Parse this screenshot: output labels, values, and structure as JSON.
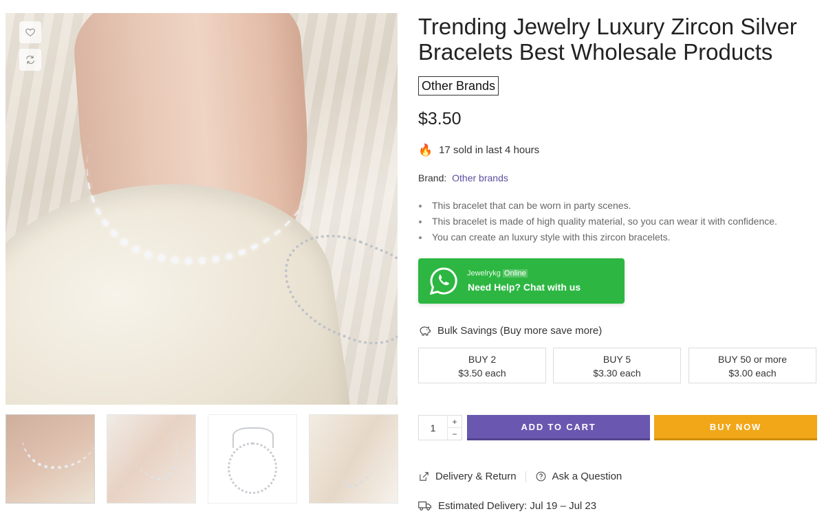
{
  "product": {
    "title": "Trending Jewelry Luxury Zircon Silver Bracelets Best Wholesale Products",
    "brand_badge": "Other Brands",
    "price": "$3.50",
    "sold_text": "17 sold in last 4 hours",
    "brand_label": "Brand:",
    "brand_value": "Other brands",
    "features": [
      "This bracelet that can be worn in party scenes.",
      "This bracelet is made of high quality material, so you can wear it with confidence.",
      "You can create an luxury style with this zircon bracelets."
    ]
  },
  "gallery": {
    "wishlist_icon": "heart-icon",
    "compare_icon": "refresh-icon",
    "thumbnail_count": 4
  },
  "whatsapp": {
    "name": "Jewelrykg",
    "status": "Online",
    "cta": "Need Help? Chat with us",
    "color": "#2db742"
  },
  "bulk": {
    "title": "Bulk Savings (Buy more save more)",
    "tiers": [
      {
        "qty": "BUY 2",
        "price": "$3.50 each"
      },
      {
        "qty": "BUY 5",
        "price": "$3.30 each"
      },
      {
        "qty": "BUY 50 or more",
        "price": "$3.00 each"
      }
    ]
  },
  "purchase": {
    "quantity": "1",
    "plus": "+",
    "minus": "−",
    "add_to_cart": "ADD TO CART",
    "buy_now": "BUY NOW",
    "cart_color": "#6a57b0",
    "buy_color": "#f1a718"
  },
  "links": {
    "delivery_return": "Delivery & Return",
    "ask_question": "Ask a Question"
  },
  "delivery": {
    "estimated": "Estimated Delivery: Jul 19 – Jul 23"
  }
}
